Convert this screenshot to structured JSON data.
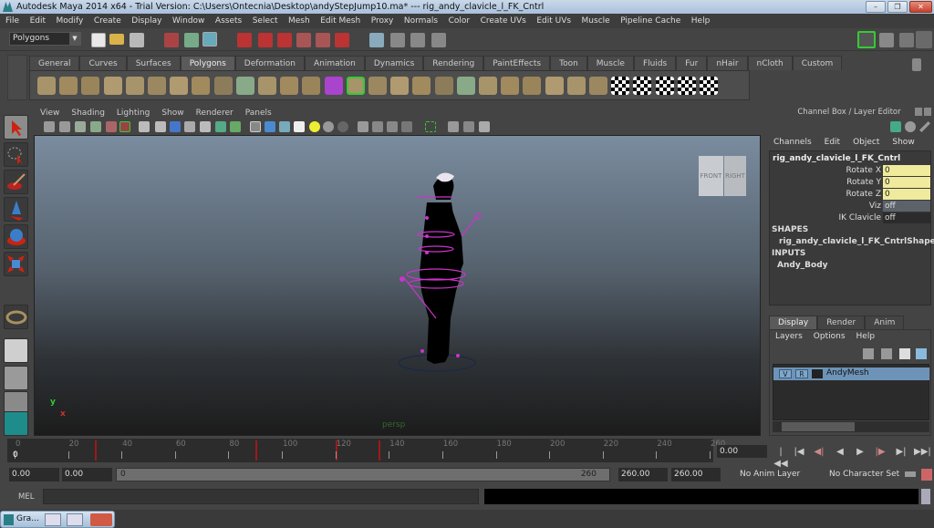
{
  "window": {
    "title": "Autodesk Maya 2014 x64 - Trial Version: C:\\Users\\Ontecnia\\Desktop\\andyStepJump10.ma*   ---   rig_andy_clavicle_l_FK_Cntrl",
    "minimize": "–",
    "restore": "❐",
    "close": "✕"
  },
  "menubar": [
    "File",
    "Edit",
    "Modify",
    "Create",
    "Display",
    "Window",
    "Assets",
    "Select",
    "Mesh",
    "Edit Mesh",
    "Proxy",
    "Normals",
    "Color",
    "Create UVs",
    "Edit UVs",
    "Muscle",
    "Pipeline Cache",
    "Help"
  ],
  "statusline": {
    "mode": "Polygons",
    "mode_arrow": "▼"
  },
  "shelf": {
    "tabs": [
      "General",
      "Curves",
      "Surfaces",
      "Polygons",
      "Deformation",
      "Animation",
      "Dynamics",
      "Rendering",
      "PaintEffects",
      "Toon",
      "Muscle",
      "Fluids",
      "Fur",
      "nHair",
      "nCloth",
      "Custom"
    ],
    "active_tab": "Polygons",
    "icons": [
      "poly-sphere",
      "poly-cube",
      "poly-cylinder",
      "poly-cone",
      "poly-plane",
      "poly-torus",
      "poly-pyramid",
      "poly-pipe",
      "poly-platonic",
      "combine",
      "separate",
      "smooth",
      "extract",
      "booleans",
      "poly-smooth",
      "mirror",
      "cut-faces",
      "extrude",
      "bridge",
      "append-polygon",
      "split-polygon",
      "insert-edge-loop",
      "offset-edge-loop",
      "bevel",
      "merge",
      "sculpt",
      "planar-map",
      "cylindrical-map",
      "spherical-map",
      "automatic-map",
      "uv-editor"
    ]
  },
  "viewport": {
    "menu": [
      "View",
      "Shading",
      "Lighting",
      "Show",
      "Renderer",
      "Panels"
    ],
    "camera_label": "persp",
    "viewcube": {
      "front": "FRONT",
      "right": "RIGHT"
    },
    "axis": {
      "y": "y",
      "x": "x"
    }
  },
  "channel_box": {
    "title": "Channel Box / Layer Editor",
    "menu": [
      "Channels",
      "Edit",
      "Object",
      "Show"
    ],
    "object": "rig_andy_clavicle_l_FK_Cntrl",
    "channels": [
      {
        "name": "Rotate X",
        "value": "0",
        "style": "keyed"
      },
      {
        "name": "Rotate Y",
        "value": "0",
        "style": "keyed"
      },
      {
        "name": "Rotate Z",
        "value": "0",
        "style": "keyed"
      },
      {
        "name": "Viz",
        "value": "off",
        "style": "locked"
      },
      {
        "name": "IK Clavicle",
        "value": "off",
        "style": "normal"
      }
    ],
    "shapes_header": "SHAPES",
    "shape": "rig_andy_clavicle_l_FK_CntrlShape",
    "inputs_header": "INPUTS",
    "input": "Andy_Body"
  },
  "layer_editor": {
    "tabs": [
      "Display",
      "Render",
      "Anim"
    ],
    "active_tab": "Display",
    "menu": [
      "Layers",
      "Options",
      "Help"
    ],
    "layers": [
      {
        "visible": "V",
        "reference": "R",
        "name": "AndyMesh"
      }
    ]
  },
  "timeline": {
    "ticks": [
      "0",
      "20",
      "40",
      "60",
      "80",
      "100",
      "120",
      "140",
      "160",
      "180",
      "200",
      "220",
      "240",
      "260"
    ],
    "current_frame": "0",
    "current_time": "0.00",
    "keyframes": [
      30,
      90,
      120,
      136
    ]
  },
  "playback": [
    "|◀◀",
    "|◀",
    "◀|",
    "◀",
    "▶",
    "|▶",
    "▶|",
    "▶▶|"
  ],
  "range": {
    "start_time": "0.00",
    "playback_start": "0.00",
    "slider_start": "0",
    "slider_end": "260",
    "playback_end": "260.00",
    "end_time": "260.00",
    "anim_layer": "No Anim Layer",
    "character_set": "No Character Set"
  },
  "command_line": {
    "label": "MEL"
  },
  "taskbar": {
    "item": "Gra..."
  }
}
